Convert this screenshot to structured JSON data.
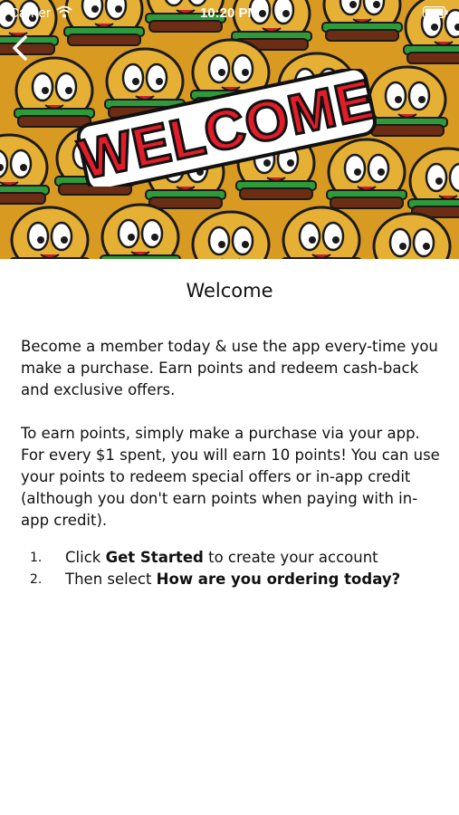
{
  "status_bar": {
    "carrier": "Carrier",
    "time": "10:20 PM"
  },
  "nav": {
    "back_icon": "chevron-left-icon"
  },
  "hero": {
    "logo_text": "WELCOME"
  },
  "page": {
    "title": "Welcome",
    "paragraph1": "Become a member today & use the app every-time you make a purchase. Earn points and redeem cash-back and exclusive offers.",
    "paragraph2": "To earn points, simply make a purchase via your app. For every $1 spent, you will earn 10 points! You can use your points to redeem special offers or in-app credit (although you don't earn points when paying with in-app credit).",
    "steps": [
      {
        "number": "1.",
        "before": "Click ",
        "bold": "Get Started",
        "after": " to create your account"
      },
      {
        "number": "2.",
        "before": "Then select ",
        "bold": "How are you ordering today?",
        "after": ""
      }
    ]
  },
  "colors": {
    "logo_red": "#e11d2a",
    "burger_bun": "#e3ac2c",
    "lettuce": "#2e9b3a"
  }
}
